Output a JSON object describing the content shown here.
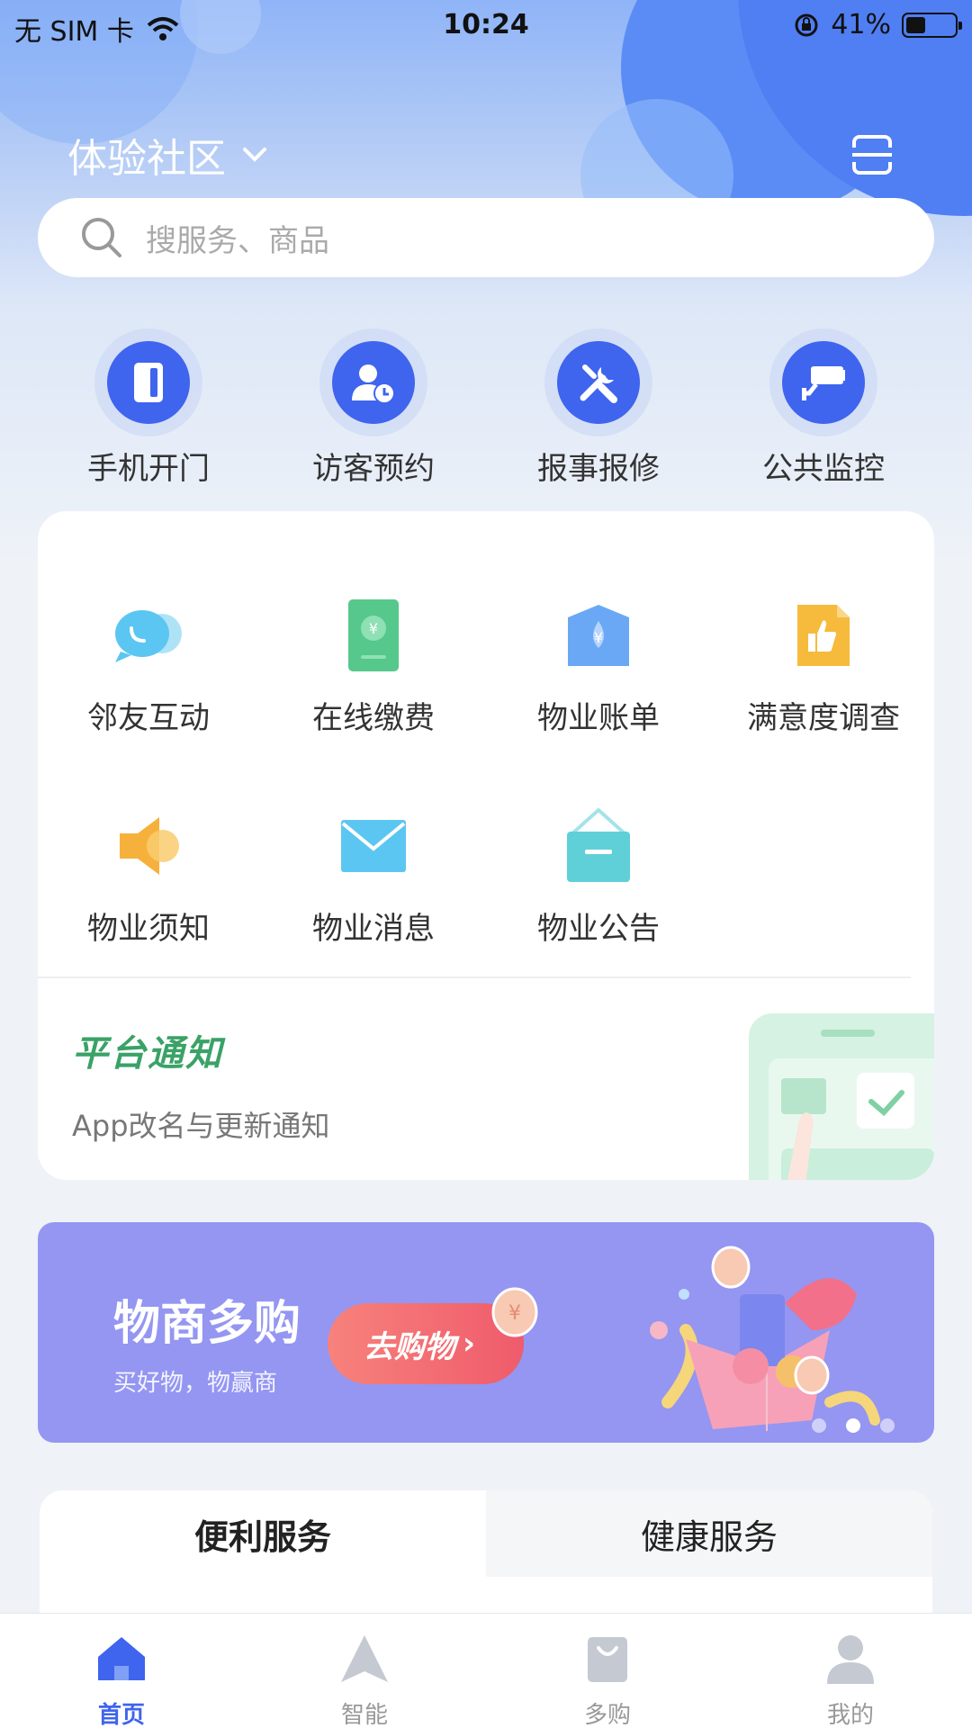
{
  "status_bar": {
    "carrier": "无 SIM 卡",
    "time": "10:24",
    "battery": "41%",
    "battery_level": 0.41
  },
  "header": {
    "community": "体验社区"
  },
  "search": {
    "placeholder": "搜服务、商品"
  },
  "quick_actions": [
    {
      "label": "手机开门",
      "icon": "door-icon"
    },
    {
      "label": "访客预约",
      "icon": "visitor-icon"
    },
    {
      "label": "报事报修",
      "icon": "tools-icon"
    },
    {
      "label": "公共监控",
      "icon": "camera-icon"
    }
  ],
  "services": [
    {
      "label": "邻友互动",
      "icon": "chat-icon",
      "color": "#5cc6f2"
    },
    {
      "label": "在线缴费",
      "icon": "payment-icon",
      "color": "#56c88b"
    },
    {
      "label": "物业账单",
      "icon": "bill-icon",
      "color": "#6aa8f5"
    },
    {
      "label": "满意度调查",
      "icon": "thumbs-up-icon",
      "color": "#f6bb3c"
    },
    {
      "label": "物业须知",
      "icon": "speaker-icon",
      "color": "#f6b13c"
    },
    {
      "label": "物业消息",
      "icon": "mail-icon",
      "color": "#5cc6f2"
    },
    {
      "label": "物业公告",
      "icon": "notice-board-icon",
      "color": "#5fd0d8"
    }
  ],
  "notice": {
    "title": "平台通知",
    "text": "App改名与更新通知"
  },
  "banner": {
    "title": "物商多购",
    "subtitle": "买好物，物赢商",
    "button": "去购物",
    "slides": 3,
    "active_slide": 1
  },
  "tabs": [
    {
      "label": "便利服务",
      "active": true
    },
    {
      "label": "健康服务",
      "active": false
    }
  ],
  "bottom_nav": [
    {
      "label": "首页",
      "icon": "home-icon",
      "active": true
    },
    {
      "label": "智能",
      "icon": "navigation-icon",
      "active": false
    },
    {
      "label": "多购",
      "icon": "shopping-bag-icon",
      "active": false
    },
    {
      "label": "我的",
      "icon": "user-icon",
      "active": false
    }
  ],
  "colors": {
    "primary": "#3f64ee",
    "notice_green": "#3aa267",
    "banner_bg": "#9496f2"
  }
}
